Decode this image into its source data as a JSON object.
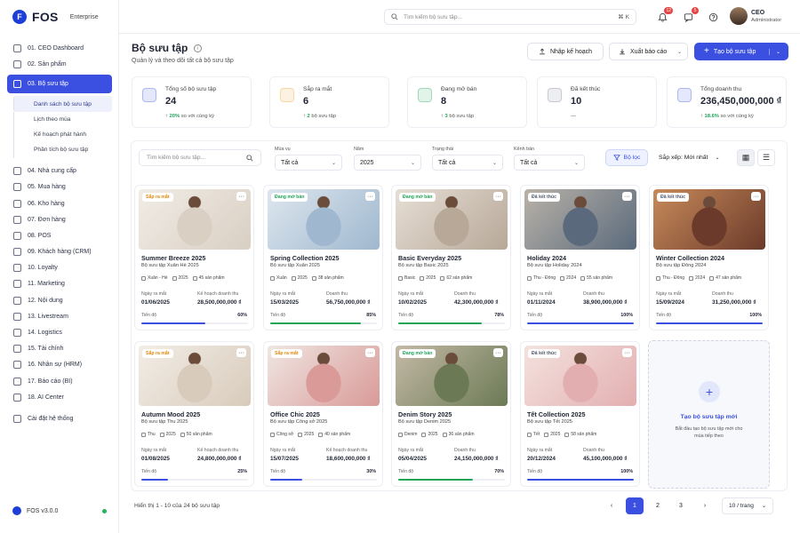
{
  "brand": {
    "name": "FOS",
    "edition": "Enterprise",
    "version": "FOS v3.0.0"
  },
  "sidebar": {
    "items": [
      {
        "label": "01. CEO Dashboard"
      },
      {
        "label": "02. Sản phẩm"
      },
      {
        "label": "03. Bộ sưu tập",
        "active": true
      },
      {
        "label": "04. Nhà cung cấp"
      },
      {
        "label": "05. Mua hàng"
      },
      {
        "label": "06. Kho hàng"
      },
      {
        "label": "07. Đơn hàng"
      },
      {
        "label": "08. POS"
      },
      {
        "label": "09. Khách hàng (CRM)"
      },
      {
        "label": "10. Loyalty"
      },
      {
        "label": "11. Marketing"
      },
      {
        "label": "12. Nội dung"
      },
      {
        "label": "13. Livestream"
      },
      {
        "label": "14. Logistics"
      },
      {
        "label": "15. Tài chính"
      },
      {
        "label": "16. Nhân sự (HRM)"
      },
      {
        "label": "17. Báo cáo (BI)"
      },
      {
        "label": "18. AI Center"
      },
      {
        "label": "Cài đặt hệ thống"
      }
    ],
    "subitems": [
      {
        "label": "Danh sách bộ sưu tập",
        "active": true
      },
      {
        "label": "Lịch theo mùa"
      },
      {
        "label": "Kế hoạch phát hành"
      },
      {
        "label": "Phân tích bộ sưu tập"
      }
    ]
  },
  "topbar": {
    "search_placeholder": "Tìm kiếm bộ sưu tập...",
    "shortcut": "⌘ K",
    "bell_count": "12",
    "message_count": "5",
    "user_name": "CEO",
    "user_role": "Administrator"
  },
  "header": {
    "title": "Bộ sưu tập",
    "subtitle": "Quản lý và theo dõi tất cả bộ sưu tập",
    "import_label": "Nhập kế hoạch",
    "export_label": "Xuất báo cáo",
    "create_label": "Tạo bộ sưu tập"
  },
  "stats": [
    {
      "label": "Tổng số bộ sưu tập",
      "value": "24",
      "change": "20%",
      "note": "so với cùng kỳ",
      "color": "#3b50e0"
    },
    {
      "label": "Sắp ra mắt",
      "value": "6",
      "change": "2",
      "note": "bộ sưu tập",
      "color": "#f0a020"
    },
    {
      "label": "Đang mở bán",
      "value": "8",
      "change": "3",
      "note": "bộ sưu tập",
      "color": "#22a35a"
    },
    {
      "label": "Đã kết thúc",
      "value": "10",
      "change": "",
      "note": "—",
      "color": "#7a8094"
    },
    {
      "label": "Tổng doanh thu",
      "value": "236,450,000,000 ₫",
      "change": "18.6%",
      "note": "so với cùng kỳ",
      "color": "#3b50e0"
    }
  ],
  "filters": {
    "search_placeholder": "Tìm kiếm bộ sưu tập...",
    "season": {
      "label": "Mùa vụ",
      "value": "Tất cả"
    },
    "year": {
      "label": "Năm",
      "value": "2025"
    },
    "status": {
      "label": "Trạng thái",
      "value": "Tất cả"
    },
    "channel": {
      "label": "Kênh bán",
      "value": "Tất cả"
    },
    "filter_label": "Bộ lọc",
    "sort_label": "Sắp xếp: Mới nhất"
  },
  "card_labels": {
    "launch": "Ngày ra mắt",
    "progress": "Tiến độ"
  },
  "cards": [
    {
      "status": "Sắp ra mắt",
      "status_color": "#e08a10",
      "title": "Summer Breeze 2025",
      "sub": "Bộ sưu tập Xuân Hè 2025",
      "season": "Xuân - Hè",
      "year": "2025",
      "count": "45 sản phẩm",
      "date": "01/06/2025",
      "metric_label": "Kế hoạch doanh thu",
      "metric": "28,500,000,000 ₫",
      "progress_text": "60%",
      "progress": 0.6,
      "bar_color": "#3b50e0",
      "img": [
        "#d9cfc3",
        "#f1ece6"
      ]
    },
    {
      "status": "Đang mở bán",
      "status_color": "#22a35a",
      "title": "Spring Collection 2025",
      "sub": "Bộ sưu tập Xuân 2025",
      "season": "Xuân",
      "year": "2025",
      "count": "38 sản phẩm",
      "date": "15/03/2025",
      "metric_label": "Doanh thu",
      "metric": "56,750,000,000 ₫",
      "progress_text": "85%",
      "progress": 0.85,
      "bar_color": "#22a35a",
      "img": [
        "#9fb8cf",
        "#dde6ee"
      ]
    },
    {
      "status": "Đang mở bán",
      "status_color": "#22a35a",
      "title": "Basic Everyday 2025",
      "sub": "Bộ sưu tập Basic 2025",
      "season": "Basic",
      "year": "2025",
      "count": "62 sản phẩm",
      "date": "10/02/2025",
      "metric_label": "Doanh thu",
      "metric": "42,300,000,000 ₫",
      "progress_text": "78%",
      "progress": 0.78,
      "bar_color": "#22a35a",
      "img": [
        "#b7a898",
        "#e6ded5"
      ]
    },
    {
      "status": "Đã kết thúc",
      "status_color": "#555b6e",
      "title": "Holiday 2024",
      "sub": "Bộ sưu tập Holiday 2024",
      "season": "Thu - Đông",
      "year": "2024",
      "count": "55 sản phẩm",
      "date": "01/11/2024",
      "metric_label": "Doanh thu",
      "metric": "38,900,000,000 ₫",
      "progress_text": "100%",
      "progress": 1.0,
      "bar_color": "#3b50e0",
      "img": [
        "#5a6a7c",
        "#b9b2a8"
      ]
    },
    {
      "status": "Đã kết thúc",
      "status_color": "#555b6e",
      "title": "Winter Collection 2024",
      "sub": "Bộ sưu tập Đông 2024",
      "season": "Thu - Đông",
      "year": "2024",
      "count": "47 sản phẩm",
      "date": "15/09/2024",
      "metric_label": "Doanh thu",
      "metric": "31,250,000,000 ₫",
      "progress_text": "100%",
      "progress": 1.0,
      "bar_color": "#3b50e0",
      "img": [
        "#6b3a2a",
        "#c78a5a"
      ]
    },
    {
      "status": "Sắp ra mắt",
      "status_color": "#e08a10",
      "title": "Autumn Mood 2025",
      "sub": "Bộ sưu tập Thu 2025",
      "season": "Thu",
      "year": "2025",
      "count": "50 sản phẩm",
      "date": "01/08/2025",
      "metric_label": "Kế hoạch doanh thu",
      "metric": "24,800,000,000 ₫",
      "progress_text": "25%",
      "progress": 0.25,
      "bar_color": "#3b50e0",
      "img": [
        "#d8cbbb",
        "#f2ede6"
      ]
    },
    {
      "status": "Sắp ra mắt",
      "status_color": "#e08a10",
      "title": "Office Chic 2025",
      "sub": "Bộ sưu tập Công sở 2025",
      "season": "Công sở",
      "year": "2025",
      "count": "40 sản phẩm",
      "date": "15/07/2025",
      "metric_label": "Kế hoạch doanh thu",
      "metric": "18,600,000,000 ₫",
      "progress_text": "30%",
      "progress": 0.3,
      "bar_color": "#3b50e0",
      "img": [
        "#d99a98",
        "#efe6e2"
      ]
    },
    {
      "status": "Đang mở bán",
      "status_color": "#22a35a",
      "title": "Denim Story 2025",
      "sub": "Bộ sưu tập Denim 2025",
      "season": "Denim",
      "year": "2025",
      "count": "36 sản phẩm",
      "date": "05/04/2025",
      "metric_label": "Doanh thu",
      "metric": "24,150,000,000 ₫",
      "progress_text": "70%",
      "progress": 0.7,
      "bar_color": "#22a35a",
      "img": [
        "#6b7a55",
        "#c4b9a6"
      ]
    },
    {
      "status": "Đã kết thúc",
      "status_color": "#555b6e",
      "title": "Tết Collection 2025",
      "sub": "Bộ sưu tập Tết 2025",
      "season": "Tết",
      "year": "2025",
      "count": "58 sản phẩm",
      "date": "20/12/2024",
      "metric_label": "Doanh thu",
      "metric": "45,100,000,000 ₫",
      "progress_text": "100%",
      "progress": 1.0,
      "bar_color": "#3b50e0",
      "img": [
        "#e3aeb0",
        "#f3e2de"
      ]
    }
  ],
  "new_card": {
    "title": "Tạo bộ sưu tập mới",
    "desc": "Bắt đầu tạo bộ sưu tập mới cho mùa tiếp theo"
  },
  "pagination": {
    "info": "Hiển thị 1 - 10 của 24 bộ sưu tập",
    "pages": [
      "1",
      "2",
      "3"
    ],
    "current": "1",
    "page_size": "10 / trang"
  }
}
